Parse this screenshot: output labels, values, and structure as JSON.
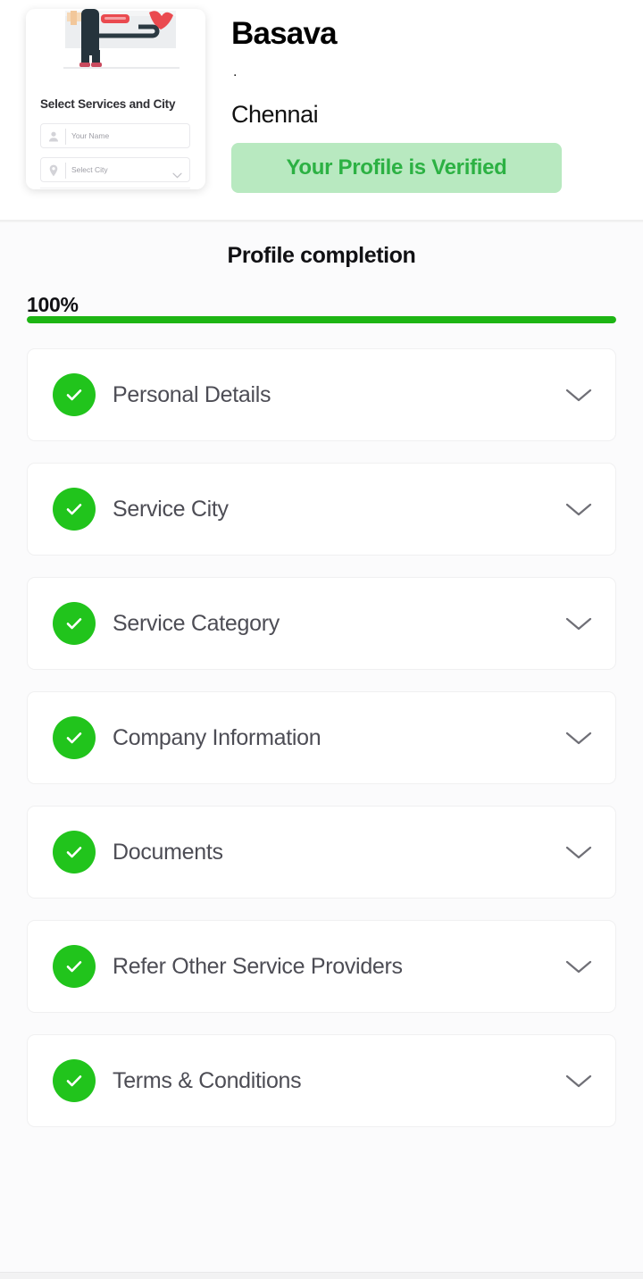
{
  "header": {
    "promo_card": {
      "title": "Select Services and  City",
      "name_field": {
        "placeholder": "Your Name",
        "value": ""
      },
      "city_field": {
        "placeholder": "Select City",
        "value": ""
      }
    },
    "user_name": "Basava",
    "separator_dot": ".",
    "city": "Chennai",
    "verified_label": "Your Profile is Verified"
  },
  "main": {
    "section_title": "Profile completion",
    "completion_percent_label": "100%",
    "completion_percent": 100,
    "rows": [
      {
        "label": "Personal Details",
        "status": "complete"
      },
      {
        "label": "Service City",
        "status": "complete"
      },
      {
        "label": "Service Category",
        "status": "complete"
      },
      {
        "label": "Company Information",
        "status": "complete"
      },
      {
        "label": "Documents",
        "status": "complete"
      },
      {
        "label": "Refer Other Service Providers",
        "status": "complete"
      },
      {
        "label": "Terms & Conditions",
        "status": "complete"
      }
    ]
  },
  "colors": {
    "progress_green": "#1db514",
    "check_green": "#21c41c",
    "badge_bg": "#b8e9c0",
    "badge_text": "#2cb143",
    "page_bg": "#fbfbfc",
    "card_bg": "#ffffff",
    "label_text": "#4d4d55"
  }
}
